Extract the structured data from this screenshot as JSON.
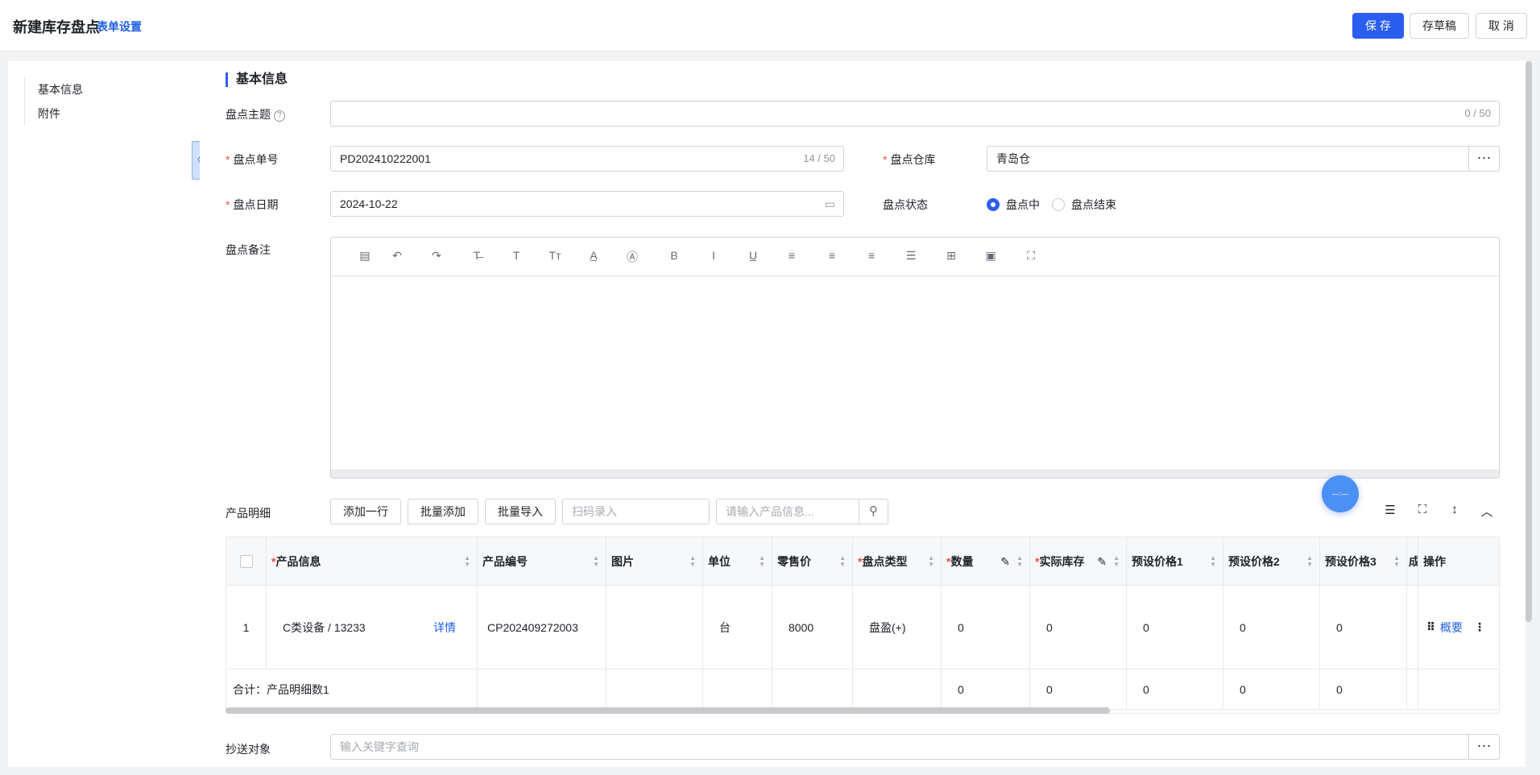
{
  "header": {
    "title": "新建库存盘点",
    "form_setting": "表单设置",
    "save": "保 存",
    "draft": "存草稿",
    "cancel": "取 消"
  },
  "sidebar": {
    "items": [
      "基本信息",
      "附件"
    ],
    "collapse_glyph": "〈"
  },
  "section": {
    "title": "基本信息"
  },
  "form": {
    "subject": {
      "label": "盘点主题",
      "value": "",
      "counter": "0 / 50"
    },
    "order_no": {
      "label": "盘点单号",
      "value": "PD202410222001",
      "counter": "14 / 50"
    },
    "warehouse": {
      "label": "盘点仓库",
      "value": "青岛仓"
    },
    "date": {
      "label": "盘点日期",
      "value": "2024-10-22"
    },
    "status": {
      "label": "盘点状态",
      "options": [
        "盘点中",
        "盘点结束"
      ],
      "selected": "盘点中"
    },
    "remark": {
      "label": "盘点备注"
    },
    "cc": {
      "label": "抄送对象",
      "placeholder": "输入关键字查询"
    }
  },
  "editor": {
    "tools": [
      "layout-icon",
      "undo-icon",
      "redo-icon",
      "strikethrough-icon",
      "text-icon",
      "font-size-icon",
      "font-color-icon",
      "bg-color-icon",
      "bold-icon",
      "italic-icon",
      "underline-icon",
      "align-left-icon",
      "align-center-icon",
      "align-right-icon",
      "justify-icon",
      "table-icon",
      "image-icon",
      "fullscreen-icon"
    ],
    "glyphs": [
      "▤",
      "↶",
      "↷",
      "T̶",
      "T",
      "Tт",
      "A̲",
      "Ⓐ",
      "B",
      "I",
      "U̲",
      "≡",
      "≡",
      "≡",
      "☰",
      "⊞",
      "▣",
      "⛶"
    ]
  },
  "products": {
    "label": "产品明细",
    "add_row": "添加一行",
    "batch_add": "批量添加",
    "batch_import": "批量导入",
    "scan_placeholder": "扫码录入",
    "search_placeholder": "请输入产品信息...",
    "float_ball": "—:—"
  },
  "table": {
    "headers": {
      "product_info": "产品信息",
      "product_code": "产品编号",
      "image": "图片",
      "unit": "单位",
      "retail_price": "零售价",
      "count_type": "盘点类型",
      "quantity": "数量",
      "actual_stock": "实际库存",
      "preset1": "预设价格1",
      "preset2": "预设价格2",
      "preset3": "预设价格3",
      "truncated": "成",
      "action": "操作"
    },
    "rows": [
      {
        "index": "1",
        "product_info": "C类设备 / 13233",
        "detail": "详情",
        "product_code": "CP202409272003",
        "image": "",
        "unit": "台",
        "retail_price": "8000",
        "count_type": "盘盈(+)",
        "quantity": "0",
        "actual_stock": "0",
        "preset1": "0",
        "preset2": "0",
        "preset3": "0",
        "overview": "概要"
      }
    ],
    "summary": {
      "label": "合计：产品明细数1",
      "quantity": "0",
      "actual_stock": "0",
      "preset1": "0",
      "preset2": "0",
      "preset3": "0"
    }
  },
  "colors": {
    "accent": "#2b5ef0",
    "link": "#1f5fe8",
    "required": "#f54a45"
  }
}
